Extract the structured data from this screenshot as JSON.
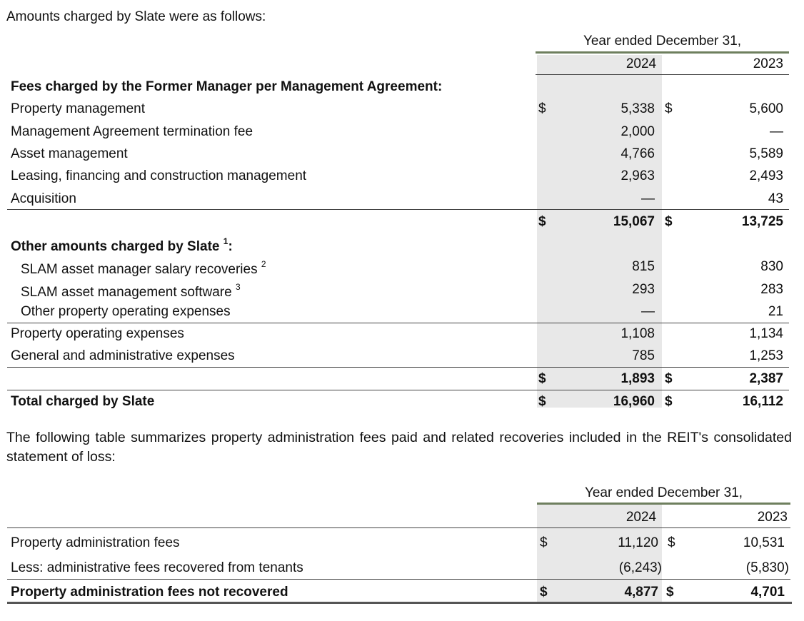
{
  "intro": "Amounts charged by Slate were as follows:",
  "t1": {
    "header": {
      "period": "Year ended December 31,",
      "y1": "2024",
      "y2": "2023"
    },
    "fees_heading": "Fees charged by the Former Manager per Management Agreement:",
    "fees_rows": [
      {
        "label": "Property management",
        "cur": "$",
        "v1": "5,338",
        "cur2": "$",
        "v2": "5,600"
      },
      {
        "label": "Management Agreement termination fee",
        "cur": "",
        "v1": "2,000",
        "cur2": "",
        "v2": "—"
      },
      {
        "label": "Asset management",
        "cur": "",
        "v1": "4,766",
        "cur2": "",
        "v2": "5,589"
      },
      {
        "label": "Leasing, financing and construction management",
        "cur": "",
        "v1": "2,963",
        "cur2": "",
        "v2": "2,493"
      },
      {
        "label": "Acquisition",
        "cur": "",
        "v1": "—",
        "cur2": "",
        "v2": "43"
      }
    ],
    "fees_subtotal": {
      "cur": "$",
      "v1": "15,067",
      "cur2": "$",
      "v2": "13,725"
    },
    "other_heading": "Other amounts charged by Slate",
    "other_heading_sup": "1",
    "other_heading_colon": ":",
    "other_rows": [
      {
        "label": "SLAM asset manager salary recoveries",
        "sup": "2",
        "v1": "815",
        "v2": "830"
      },
      {
        "label": "SLAM asset management software",
        "sup": "3",
        "v1": "293",
        "v2": "283"
      },
      {
        "label": "Other property operating expenses",
        "sup": "",
        "v1": "—",
        "v2": "21"
      }
    ],
    "expense_rows": [
      {
        "label": "Property operating expenses",
        "v1": "1,108",
        "v2": "1,134"
      },
      {
        "label": "General and administrative expenses",
        "v1": "785",
        "v2": "1,253"
      }
    ],
    "other_subtotal": {
      "cur": "$",
      "v1": "1,893",
      "cur2": "$",
      "v2": "2,387"
    },
    "total": {
      "label": "Total charged by Slate",
      "cur": "$",
      "v1": "16,960",
      "cur2": "$",
      "v2": "16,112"
    }
  },
  "paragraph": "The following table summarizes property administration fees paid and related recoveries included in the REIT's consolidated statement of loss:",
  "t2": {
    "header": {
      "period": "Year ended December 31,",
      "y1": "2024",
      "y2": "2023"
    },
    "rows": [
      {
        "label": "Property administration fees",
        "cur": "$",
        "v1": "11,120",
        "cur2": "$",
        "v2": "10,531"
      },
      {
        "label": "Less: administrative fees recovered from tenants",
        "cur": "",
        "v1": "(6,243)",
        "cur2": "",
        "v2": "(5,830)"
      }
    ],
    "total": {
      "label": "Property administration fees not recovered",
      "cur": "$",
      "v1": "4,877",
      "cur2": "$",
      "v2": "4,701"
    }
  }
}
